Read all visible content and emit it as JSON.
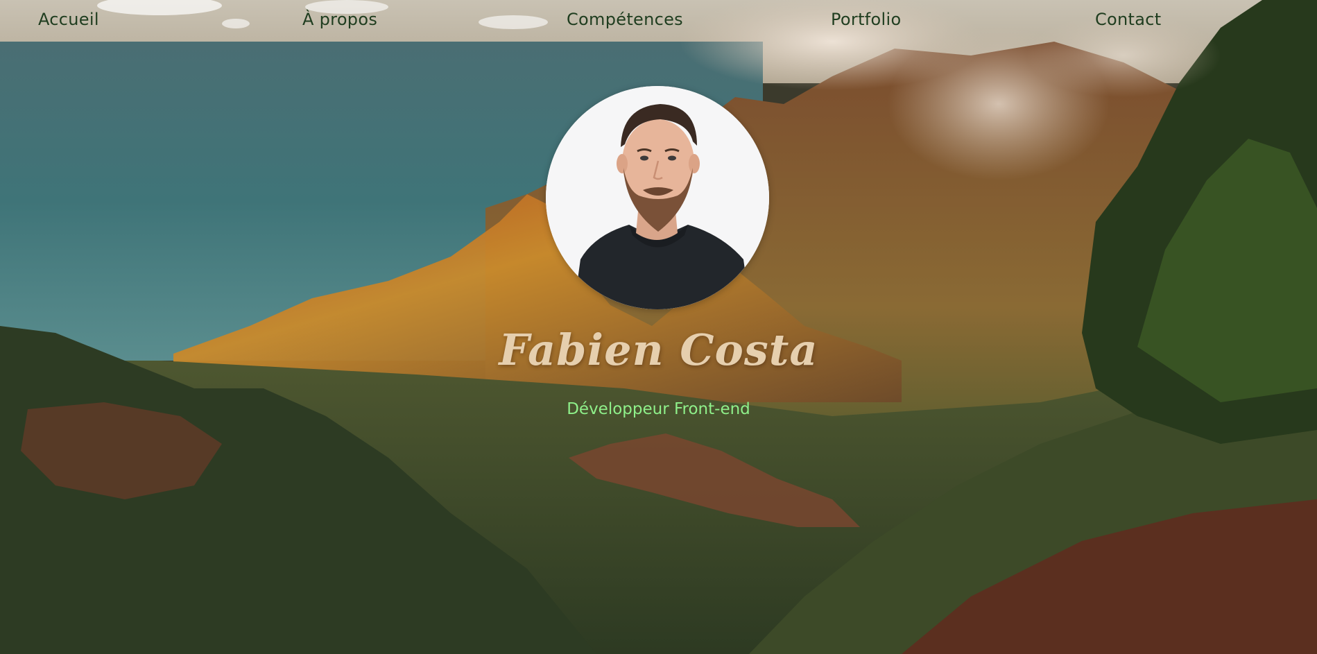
{
  "nav": {
    "items": [
      {
        "label": "Accueil"
      },
      {
        "label": "À propos"
      },
      {
        "label": "Compétences"
      },
      {
        "label": "Portfolio"
      },
      {
        "label": "Contact"
      }
    ]
  },
  "hero": {
    "name": "Fabien Costa",
    "role": "Développeur Front-end",
    "avatar_icon": "profile-photo"
  },
  "colors": {
    "nav_text": "#1f3d1f",
    "name_text": "#e6cfae",
    "role_text": "#8ff08a"
  }
}
